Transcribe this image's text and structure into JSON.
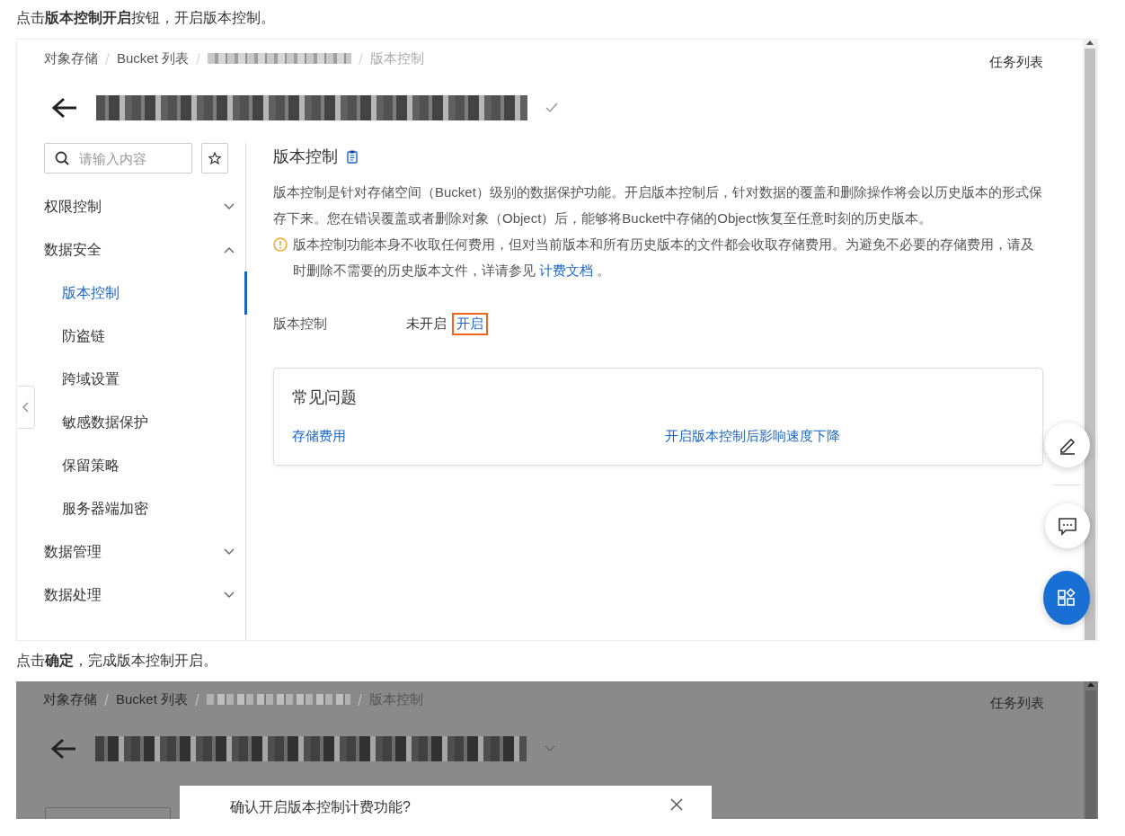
{
  "steps": [
    {
      "text": "点击**版本控制开启**按钮，开启版本控制。",
      "screenshot": {
        "kind": "console",
        "breadcrumb": [
          "对象存储",
          "Bucket 列表",
          "版本控制"
        ],
        "task_list": "任务列表",
        "search": {
          "placeholder": "请输入内容"
        },
        "menu": [
          {
            "label": "权限控制",
            "expanded": false
          },
          {
            "label": "数据安全",
            "expanded": true,
            "children": [
              {
                "label": "版本控制",
                "selected": true
              },
              {
                "label": "防盗链",
                "selected": false
              },
              {
                "label": "跨域设置",
                "selected": false
              },
              {
                "label": "敏感数据保护",
                "selected": false
              },
              {
                "label": "保留策略",
                "selected": false
              },
              {
                "label": "服务器端加密",
                "selected": false
              }
            ]
          },
          {
            "label": "数据管理",
            "expanded": false
          },
          {
            "label": "数据处理",
            "expanded": false
          }
        ],
        "section_title": "版本控制",
        "description": "版本控制是针对存储空间（Bucket）级别的数据保护功能。开启版本控制后，针对数据的覆盖和删除操作将会以历史版本的形式保存下来。您在错误覆盖或者删除对象（Object）后，能够将Bucket中存储的Object恢复至任意时刻的历史版本。",
        "warning": {
          "text": "版本控制功能本身不收取任何费用，但对当前版本和所有历史版本的文件都会收取存储费用。为避免不必要的存储费用，请及时删除不需要的历史版本文件，详请参见",
          "link": "计费文档",
          "end": " 。"
        },
        "setting": {
          "label": "版本控制",
          "status": "未开启",
          "action": "开启",
          "highlighted": true
        },
        "faq": {
          "title": "常见问题",
          "links": [
            "存储费用",
            "开启版本控制后影响速度下降"
          ]
        }
      }
    },
    {
      "text": "点击**确定**，完成版本控制开启。",
      "screenshot": {
        "kind": "dialog",
        "breadcrumb": [
          "对象存储",
          "Bucket 列表",
          "版本控制"
        ],
        "task_list": "任务列表",
        "dialog_title": "确认开启版本控制计费功能?"
      }
    }
  ]
}
